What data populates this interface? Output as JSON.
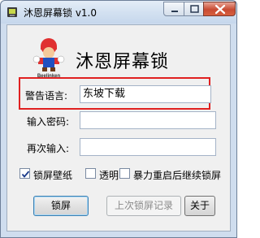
{
  "window": {
    "title": "沐恩屏幕锁 v1.0"
  },
  "logo": {
    "caption": "Beelinken"
  },
  "heading": "沐恩屏幕锁",
  "form": {
    "warning_label": "警告语言:",
    "warning_value": "东坡下载",
    "password_label": "输入密码:",
    "password_value": "",
    "confirm_label": "再次输入:",
    "confirm_value": ""
  },
  "options": [
    {
      "label": "锁屏壁纸",
      "checked": true
    },
    {
      "label": "透明",
      "checked": false
    },
    {
      "label": "暴力重启后继续锁屏",
      "checked": false
    }
  ],
  "buttons": {
    "lock": "锁屏",
    "last_record": "上次锁屏记录",
    "about": "关于"
  },
  "colors": {
    "highlight_border": "#e02020",
    "title_gradient_top": "#e4edf7",
    "close_button": "#c84b33"
  }
}
